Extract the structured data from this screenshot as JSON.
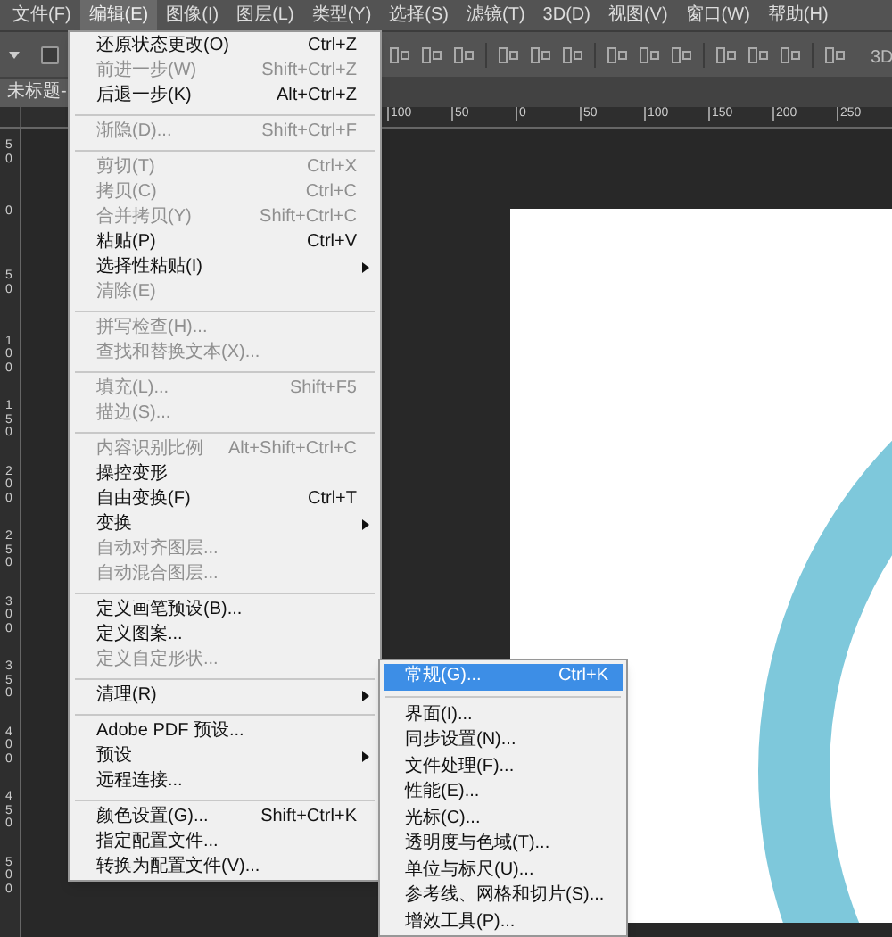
{
  "menubar": [
    {
      "label": "文件(F)",
      "selected": false
    },
    {
      "label": "编辑(E)",
      "selected": true
    },
    {
      "label": "图像(I)",
      "selected": false
    },
    {
      "label": "图层(L)",
      "selected": false
    },
    {
      "label": "类型(Y)",
      "selected": false
    },
    {
      "label": "选择(S)",
      "selected": false
    },
    {
      "label": "滤镜(T)",
      "selected": false
    },
    {
      "label": "3D(D)",
      "selected": false
    },
    {
      "label": "视图(V)",
      "selected": false
    },
    {
      "label": "窗口(W)",
      "selected": false
    },
    {
      "label": "帮助(H)",
      "selected": false
    }
  ],
  "options_bar": {
    "auto_select_checked": false,
    "right_label": "3D"
  },
  "document_tab": {
    "title": "未标题-"
  },
  "top_ruler": [
    "100",
    "50",
    "0",
    "50",
    "100",
    "150",
    "200",
    "250"
  ],
  "left_ruler": [
    "50",
    "0",
    "50",
    "100",
    "150",
    "200",
    "250",
    "300",
    "350",
    "400",
    "450",
    "500"
  ],
  "edit_menu": [
    [
      {
        "label": "还原状态更改(O)",
        "shortcut": "Ctrl+Z",
        "disabled": false,
        "submenu": false
      },
      {
        "label": "前进一步(W)",
        "shortcut": "Shift+Ctrl+Z",
        "disabled": true,
        "submenu": false
      },
      {
        "label": "后退一步(K)",
        "shortcut": "Alt+Ctrl+Z",
        "disabled": false,
        "submenu": false
      }
    ],
    [
      {
        "label": "渐隐(D)...",
        "shortcut": "Shift+Ctrl+F",
        "disabled": true,
        "submenu": false
      }
    ],
    [
      {
        "label": "剪切(T)",
        "shortcut": "Ctrl+X",
        "disabled": true,
        "submenu": false
      },
      {
        "label": "拷贝(C)",
        "shortcut": "Ctrl+C",
        "disabled": true,
        "submenu": false
      },
      {
        "label": "合并拷贝(Y)",
        "shortcut": "Shift+Ctrl+C",
        "disabled": true,
        "submenu": false
      },
      {
        "label": "粘贴(P)",
        "shortcut": "Ctrl+V",
        "disabled": false,
        "submenu": false
      },
      {
        "label": "选择性粘贴(I)",
        "disabled": false,
        "submenu": true
      },
      {
        "label": "清除(E)",
        "disabled": true,
        "submenu": false
      }
    ],
    [
      {
        "label": "拼写检查(H)...",
        "disabled": true,
        "submenu": false
      },
      {
        "label": "查找和替换文本(X)...",
        "disabled": true,
        "submenu": false
      }
    ],
    [
      {
        "label": "填充(L)...",
        "shortcut": "Shift+F5",
        "disabled": true,
        "submenu": false
      },
      {
        "label": "描边(S)...",
        "disabled": true,
        "submenu": false
      }
    ],
    [
      {
        "label": "内容识别比例",
        "shortcut": "Alt+Shift+Ctrl+C",
        "disabled": true,
        "submenu": false
      },
      {
        "label": "操控变形",
        "disabled": false,
        "submenu": false
      },
      {
        "label": "自由变换(F)",
        "shortcut": "Ctrl+T",
        "disabled": false,
        "submenu": false
      },
      {
        "label": "变换",
        "disabled": false,
        "submenu": true
      },
      {
        "label": "自动对齐图层...",
        "disabled": true,
        "submenu": false
      },
      {
        "label": "自动混合图层...",
        "disabled": true,
        "submenu": false
      }
    ],
    [
      {
        "label": "定义画笔预设(B)...",
        "disabled": false,
        "submenu": false
      },
      {
        "label": "定义图案...",
        "disabled": false,
        "submenu": false
      },
      {
        "label": "定义自定形状...",
        "disabled": true,
        "submenu": false
      }
    ],
    [
      {
        "label": "清理(R)",
        "disabled": false,
        "submenu": true
      }
    ],
    [
      {
        "label": "Adobe PDF 预设...",
        "disabled": false,
        "submenu": false
      },
      {
        "label": "预设",
        "disabled": false,
        "submenu": true
      },
      {
        "label": "远程连接...",
        "disabled": false,
        "submenu": false
      }
    ],
    [
      {
        "label": "颜色设置(G)...",
        "shortcut": "Shift+Ctrl+K",
        "disabled": false,
        "submenu": false
      },
      {
        "label": "指定配置文件...",
        "disabled": false,
        "submenu": false
      },
      {
        "label": "转换为配置文件(V)...",
        "disabled": false,
        "submenu": false
      }
    ]
  ],
  "preferences_submenu": [
    [
      {
        "label": "常规(G)...",
        "shortcut": "Ctrl+K",
        "selected": true
      }
    ],
    [
      {
        "label": "界面(I)...",
        "selected": false
      },
      {
        "label": "同步设置(N)...",
        "selected": false
      },
      {
        "label": "文件处理(F)...",
        "selected": false
      },
      {
        "label": "性能(E)...",
        "selected": false
      },
      {
        "label": "光标(C)...",
        "selected": false
      },
      {
        "label": "透明度与色域(T)...",
        "selected": false
      },
      {
        "label": "单位与标尺(U)...",
        "selected": false
      },
      {
        "label": "参考线、网格和切片(S)...",
        "selected": false
      },
      {
        "label": "增效工具(P)...",
        "selected": false
      }
    ]
  ]
}
